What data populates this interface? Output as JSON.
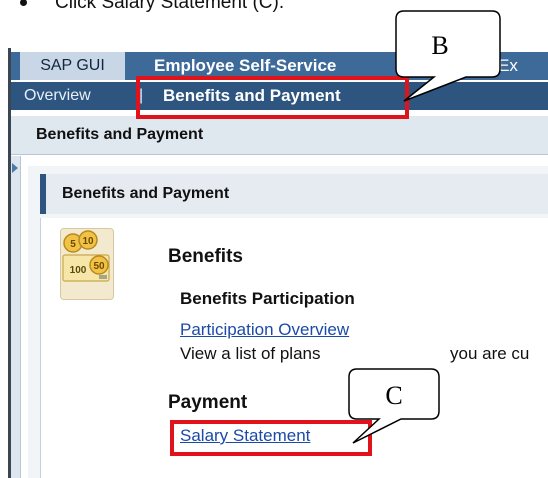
{
  "instruction": {
    "text": "Click Salary Statement (C)."
  },
  "shell": {
    "tabs": [
      {
        "label": "SAP GUI"
      },
      {
        "label": "Employee Self-Service"
      }
    ],
    "tab_overflow_text": "ss Ex",
    "nav": {
      "overview": "Overview",
      "separator": "|",
      "current": "Benefits and Payment"
    }
  },
  "page": {
    "header_title": "Benefits and Payment",
    "panel_title": "Benefits and Payment",
    "benefits": {
      "title": "Benefits",
      "subsection": "Benefits Participation",
      "link": "Participation Overview",
      "description_left": "View a list of plans",
      "description_right": "you are cu"
    },
    "payment": {
      "title": "Payment",
      "link": "Salary Statement"
    },
    "coins": {
      "c1": "5",
      "c2": "10",
      "c3": "100",
      "c4": "50"
    }
  },
  "callouts": {
    "b": "B",
    "c": "C"
  },
  "colors": {
    "highlight": "#e0131b",
    "header_bar": "#3e6a99",
    "link": "#1b4aa8"
  }
}
